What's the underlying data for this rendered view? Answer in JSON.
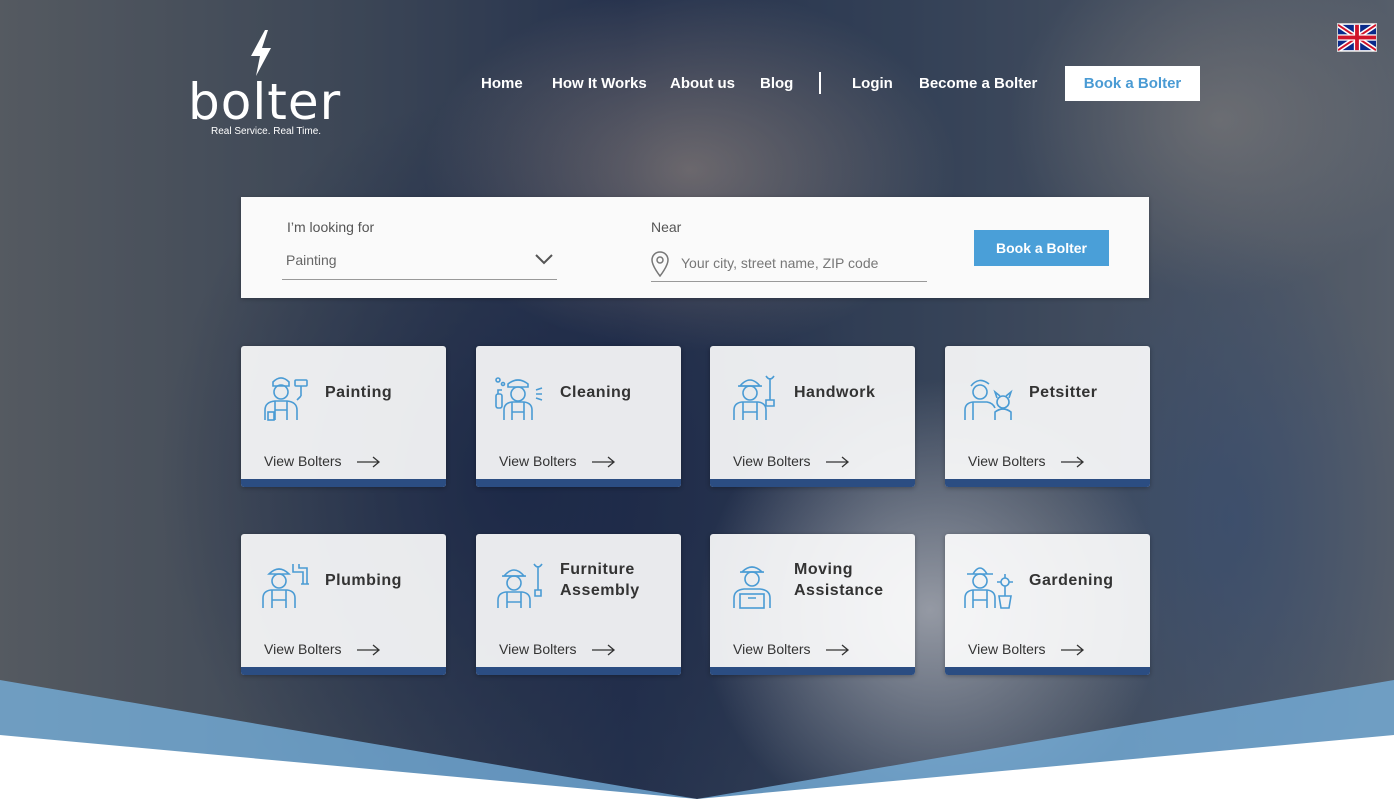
{
  "brand": {
    "name": "bolter",
    "tagline": "Real Service. Real Time."
  },
  "nav": {
    "items": [
      {
        "label": "Home"
      },
      {
        "label": "How It Works"
      },
      {
        "label": "About us"
      },
      {
        "label": "Blog"
      },
      {
        "label": "Login"
      },
      {
        "label": "Become a Bolter"
      }
    ],
    "cta": "Book a Bolter",
    "language_icon": "uk-flag-icon"
  },
  "search": {
    "looking_for_label": "I’m looking for",
    "looking_for_value": "Painting",
    "near_label": "Near",
    "near_placeholder": "Your city, street name, ZIP code",
    "submit_label": "Book a Bolter"
  },
  "categories": [
    {
      "title_line1": "Painting",
      "title_line2": "",
      "link": "View Bolters",
      "icon": "painter-icon"
    },
    {
      "title_line1": "Cleaning",
      "title_line2": "",
      "link": "View Bolters",
      "icon": "cleaner-icon"
    },
    {
      "title_line1": "Handwork",
      "title_line2": "",
      "link": "View Bolters",
      "icon": "handyman-icon"
    },
    {
      "title_line1": "Petsitter",
      "title_line2": "",
      "link": "View Bolters",
      "icon": "petsitter-icon"
    },
    {
      "title_line1": "Plumbing",
      "title_line2": "",
      "link": "View Bolters",
      "icon": "plumber-icon"
    },
    {
      "title_line1": "Furniture",
      "title_line2": "Assembly",
      "link": "View Bolters",
      "icon": "assembler-icon"
    },
    {
      "title_line1": "Moving",
      "title_line2": "Assistance",
      "link": "View Bolters",
      "icon": "mover-icon"
    },
    {
      "title_line1": "Gardening",
      "title_line2": "",
      "link": "View Bolters",
      "icon": "gardener-icon"
    }
  ],
  "colors": {
    "accent": "#4a9fd8",
    "stripe": "#2b4d82",
    "icon": "#4a9bd4"
  }
}
